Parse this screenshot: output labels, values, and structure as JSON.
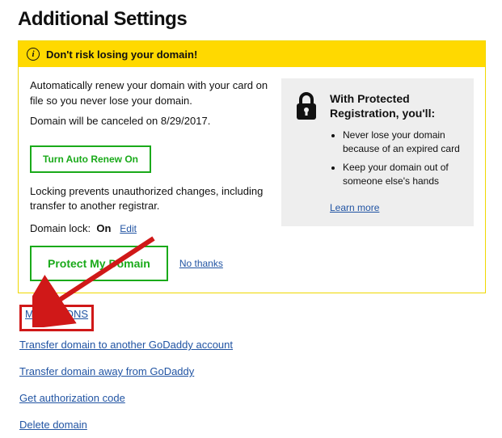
{
  "title": "Additional Settings",
  "alert": {
    "text": "Don't risk losing your domain!"
  },
  "autorenew": {
    "line1": "Automatically renew your domain with your card on file so you never lose your domain.",
    "line2": "Domain will be canceled on 8/29/2017.",
    "button": "Turn Auto Renew On"
  },
  "locking": {
    "desc": "Locking prevents unauthorized changes, including transfer to another registrar.",
    "label": "Domain lock:",
    "status": "On",
    "edit": "Edit"
  },
  "protect": {
    "button": "Protect My Domain",
    "nothanks": "No thanks"
  },
  "sidebox": {
    "heading": "With Protected Registration, you'll:",
    "bullets": [
      "Never lose your domain because of an expired card",
      "Keep your domain out of someone else's hands"
    ],
    "learn": "Learn more"
  },
  "links": {
    "manage_dns": "Manage DNS",
    "transfer_account": "Transfer domain to another GoDaddy account",
    "transfer_away": "Transfer domain away from GoDaddy",
    "auth_code": "Get authorization code",
    "delete": "Delete domain"
  }
}
